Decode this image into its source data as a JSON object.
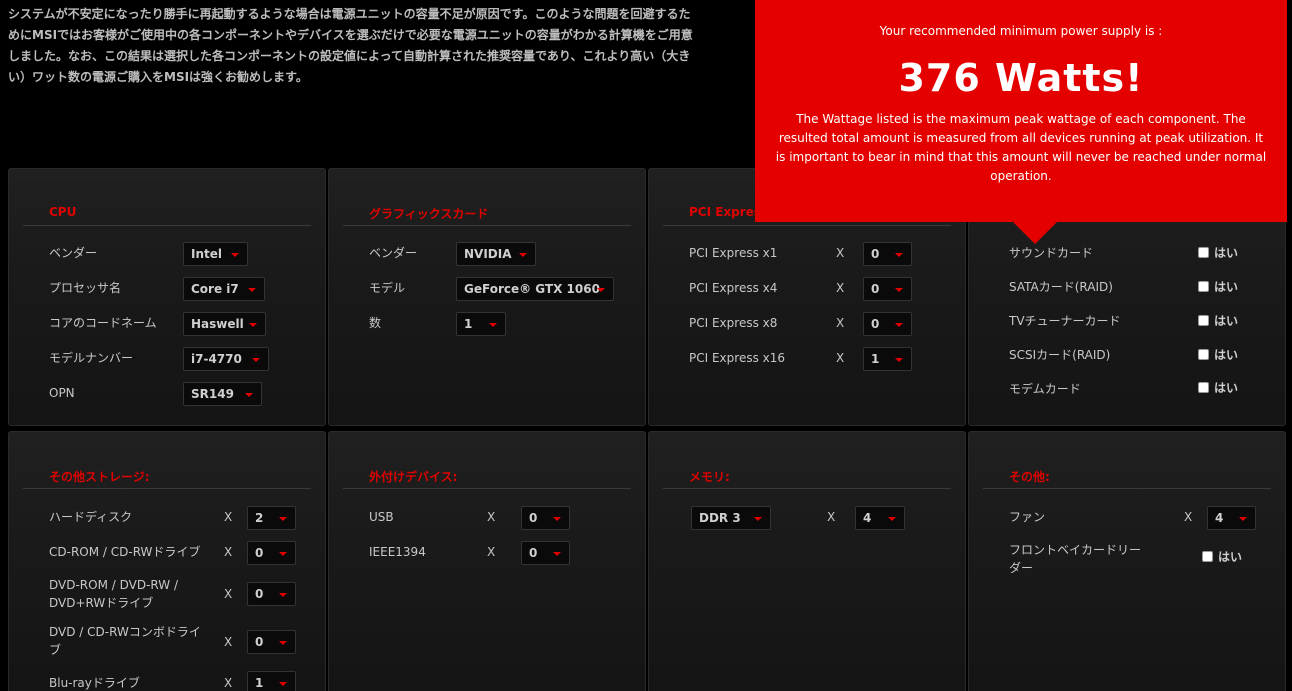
{
  "intro": "システムが不安定になったり勝手に再起動するような場合は電源ユニットの容量不足が原因です。このような問題を回避するためにMSIではお客様がご使用中の各コンポーネントやデバイスを選ぶだけで必要な電源ユニットの容量がわかる計算機をご用意しました。なお、この結果は選択した各コンポーネントの設定値によって自動計算された推奨容量であり、これより高い（大きい）ワット数の電源ご購入をMSIは強くお勧めします。",
  "popup": {
    "heading": "Your recommended minimum power supply is :",
    "watts": "376 Watts!",
    "body": "The Wattage listed is the maximum peak wattage of each component. The resulted total amount is measured from all devices running at peak utilization. It is important to bear in mind that this amount will never be reached under normal operation."
  },
  "x_mark": "X",
  "yes": "はい",
  "cpu": {
    "title": "CPU",
    "rows": [
      {
        "label": "ベンダー",
        "value": "Intel"
      },
      {
        "label": "プロセッサ名",
        "value": "Core i7"
      },
      {
        "label": "コアのコードネーム",
        "value": "Haswell"
      },
      {
        "label": "モデルナンバー",
        "value": "i7-4770"
      },
      {
        "label": "OPN",
        "value": "SR149"
      }
    ]
  },
  "gpu": {
    "title": "グラフィックスカード",
    "rows": [
      {
        "label": "ベンダー",
        "value": "NVIDIA"
      },
      {
        "label": "モデル",
        "value": "GeForce® GTX 1060"
      },
      {
        "label": "数",
        "value": "1"
      }
    ]
  },
  "pci": {
    "title": "PCI Express",
    "rows": [
      {
        "label": "PCI Express x1",
        "value": "0"
      },
      {
        "label": "PCI Express x4",
        "value": "0"
      },
      {
        "label": "PCI Express x8",
        "value": "0"
      },
      {
        "label": "PCI Express x16",
        "value": "1"
      }
    ]
  },
  "cards": {
    "rows": [
      "サウンドカード",
      "SATAカード(RAID)",
      "TVチューナーカード",
      "SCSIカード(RAID)",
      "モデムカード"
    ]
  },
  "storage": {
    "title": "その他ストレージ:",
    "rows": [
      {
        "label": "ハードディスク",
        "value": "2"
      },
      {
        "label": "CD-ROM / CD-RWドライブ",
        "value": "0"
      },
      {
        "label": "DVD-ROM / DVD-RW / DVD+RWドライブ",
        "value": "0"
      },
      {
        "label": "DVD / CD-RWコンボドライブ",
        "value": "0"
      },
      {
        "label": "Blu-rayドライブ",
        "value": "1"
      }
    ]
  },
  "external": {
    "title": "外付けデバイス:",
    "rows": [
      {
        "label": "USB",
        "value": "0"
      },
      {
        "label": "IEEE1394",
        "value": "0"
      }
    ]
  },
  "memory": {
    "title": "メモリ:",
    "type": "DDR 3",
    "count": "4"
  },
  "other": {
    "title": "その他:",
    "fan_label": "ファン",
    "fan_value": "4",
    "reader_label": "フロントベイカードリーダー"
  }
}
